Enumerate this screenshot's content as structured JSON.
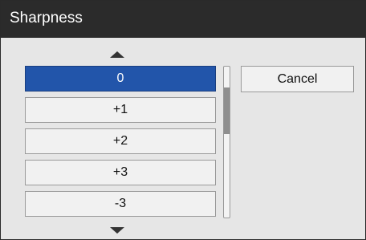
{
  "window": {
    "title": "Sharpness"
  },
  "list": {
    "items": [
      {
        "label": "0",
        "selected": true
      },
      {
        "label": "+1",
        "selected": false
      },
      {
        "label": "+2",
        "selected": false
      },
      {
        "label": "+3",
        "selected": false
      },
      {
        "label": "-3",
        "selected": false
      }
    ]
  },
  "buttons": {
    "cancel_label": "Cancel"
  },
  "icons": {
    "scroll_up": "arrow-up-icon",
    "scroll_down": "arrow-down-icon"
  },
  "colors": {
    "selected_bg": "#2255aa",
    "titlebar_bg": "#2b2b2b"
  }
}
